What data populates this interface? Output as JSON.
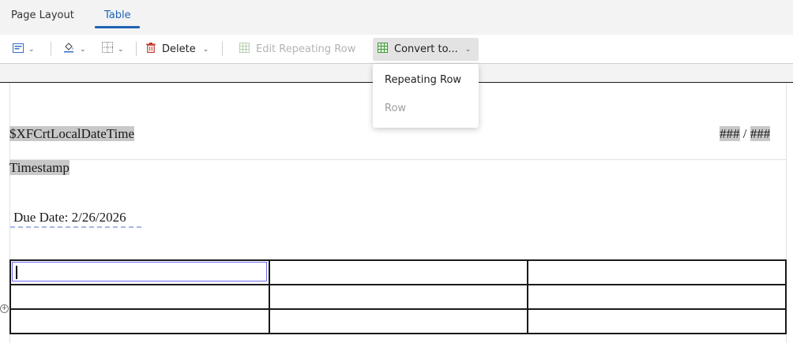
{
  "tabs": [
    {
      "label": "Page Layout",
      "active": false
    },
    {
      "label": "Table",
      "active": true
    }
  ],
  "toolbar": {
    "delete_label": "Delete",
    "edit_repeating_label": "Edit Repeating Row",
    "convert_label": "Convert to..."
  },
  "convert_menu": {
    "items": [
      {
        "label": "Repeating Row",
        "enabled": true
      },
      {
        "label": "Row",
        "enabled": false
      }
    ]
  },
  "document": {
    "header_left": "$XFCrtLocalDateTime",
    "page_num_a": "###",
    "page_sep": " / ",
    "page_num_b": "###",
    "timestamp_label": "Timestamp",
    "due_date_text": "Due Date: 2/26/2026",
    "table": {
      "rows": 3,
      "columns": 3
    }
  },
  "colors": {
    "accent": "#1f63b4",
    "field_highlight": "#c8c8c8",
    "selection_border": "#6d6df0"
  }
}
